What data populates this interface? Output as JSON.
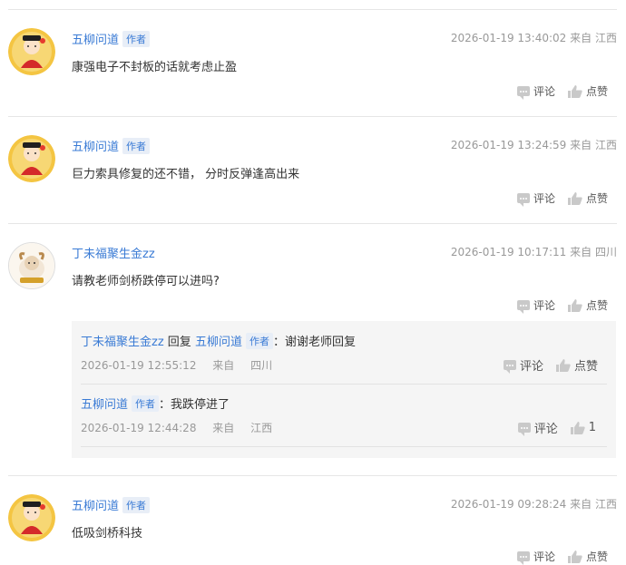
{
  "labels": {
    "author": "作者",
    "reply": "回复",
    "comment": "评论",
    "like": "点赞",
    "from": "来自"
  },
  "comments": [
    {
      "user": "五柳问道",
      "is_author": true,
      "time": "2026-01-19 13:40:02",
      "location": "江西",
      "text": "康强电子不封板的话就考虑止盈"
    },
    {
      "user": "五柳问道",
      "is_author": true,
      "time": "2026-01-19 13:24:59",
      "location": "江西",
      "text": "巨力索具修复的还不错， 分时反弹逢高出来"
    },
    {
      "user": "丁未福聚生金zz",
      "is_author": false,
      "time": "2026-01-19 10:17:11",
      "location": "四川",
      "text": "请教老师剑桥跌停可以进吗?",
      "replies": [
        {
          "user": "丁未福聚生金zz",
          "target": "五柳问道",
          "target_is_author": true,
          "text": "：谢谢老师回复",
          "time": "2026-01-19 12:55:12",
          "location": "四川",
          "like_label": "点赞"
        },
        {
          "user": "五柳问道",
          "is_author": true,
          "text": "：我跌停进了",
          "time": "2026-01-19 12:44:28",
          "location": "江西",
          "like_count": "1"
        }
      ]
    },
    {
      "user": "五柳问道",
      "is_author": true,
      "time": "2026-01-19 09:28:24",
      "location": "江西",
      "text": "低吸剑桥科技"
    }
  ],
  "colors": {
    "link": "#3a7bd5",
    "muted": "#999999",
    "icon": "#c9c9c9"
  }
}
